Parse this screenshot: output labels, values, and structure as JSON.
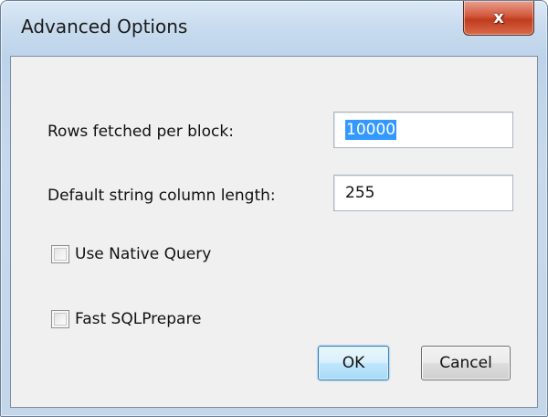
{
  "window": {
    "title": "Advanced Options",
    "close_glyph": "x"
  },
  "form": {
    "rows_label": "Rows fetched per block:",
    "rows_value": "10000",
    "string_length_label": "Default string column length:",
    "string_length_value": "255",
    "native_query_label": "Use Native Query",
    "native_query_checked": false,
    "fast_prepare_label": "Fast SQLPrepare",
    "fast_prepare_checked": false
  },
  "buttons": {
    "ok_label": "OK",
    "cancel_label": "Cancel"
  }
}
